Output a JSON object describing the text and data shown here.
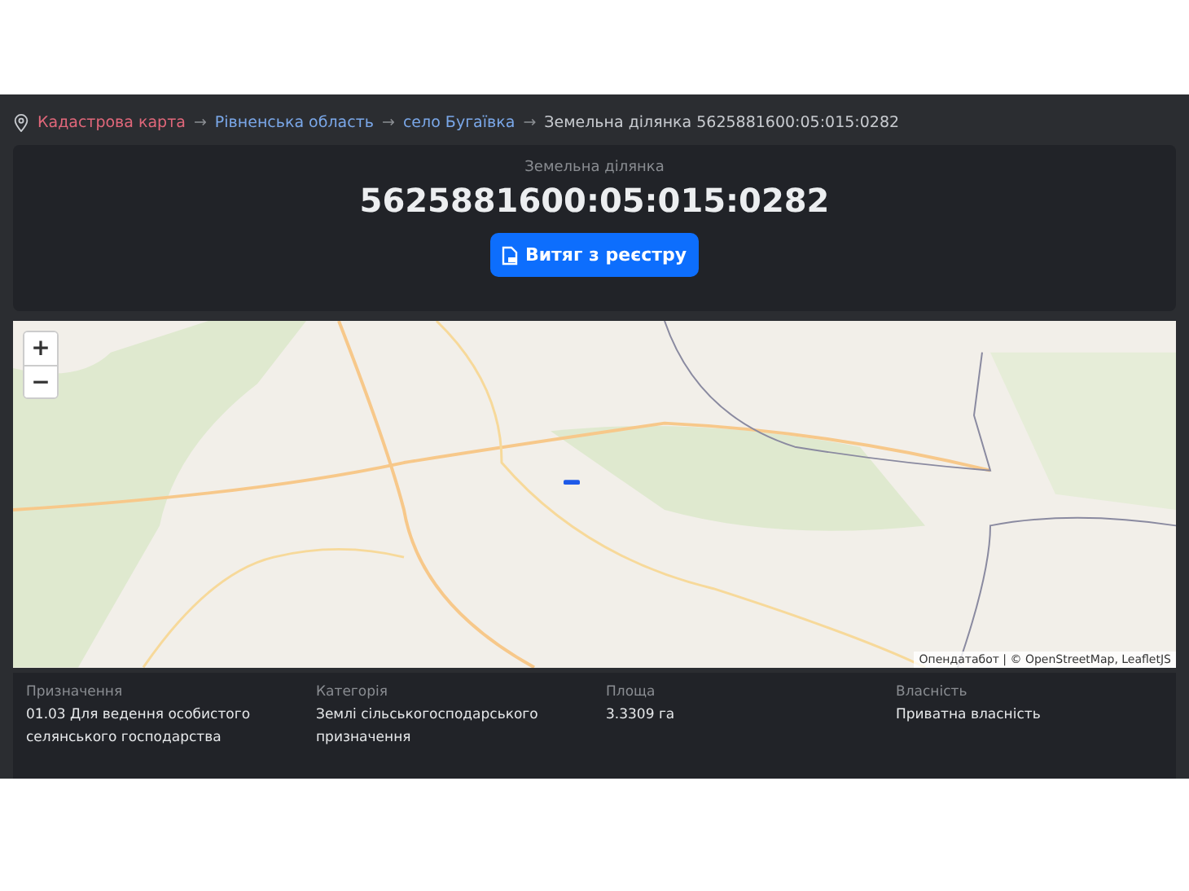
{
  "breadcrumb": [
    {
      "label": "Кадастрова карта",
      "kind": "home"
    },
    {
      "label": "Рівненська область",
      "kind": "link"
    },
    {
      "label": "село Бугаївка",
      "kind": "link"
    },
    {
      "label": "Земельна ділянка 5625881600:05:015:0282",
      "kind": "current"
    }
  ],
  "breadcrumb_separator": "→",
  "header": {
    "caption": "Земельна ділянка",
    "cadastral_number": "5625881600:05:015:0282",
    "button": "Витяг з реєстру"
  },
  "map": {
    "zoom_in": "+",
    "zoom_out": "−",
    "attribution": "Опендатабот | © OpenStreetMap, LeafletJS"
  },
  "details": [
    {
      "label": "Призначення",
      "value": "01.03 Для ведення особистого селянського господарства"
    },
    {
      "label": "Категорія",
      "value": "Землі сільськогосподарського призначення"
    },
    {
      "label": "Площа",
      "value": "3.3309 га"
    },
    {
      "label": "Власність",
      "value": "Приватна власність"
    }
  ]
}
